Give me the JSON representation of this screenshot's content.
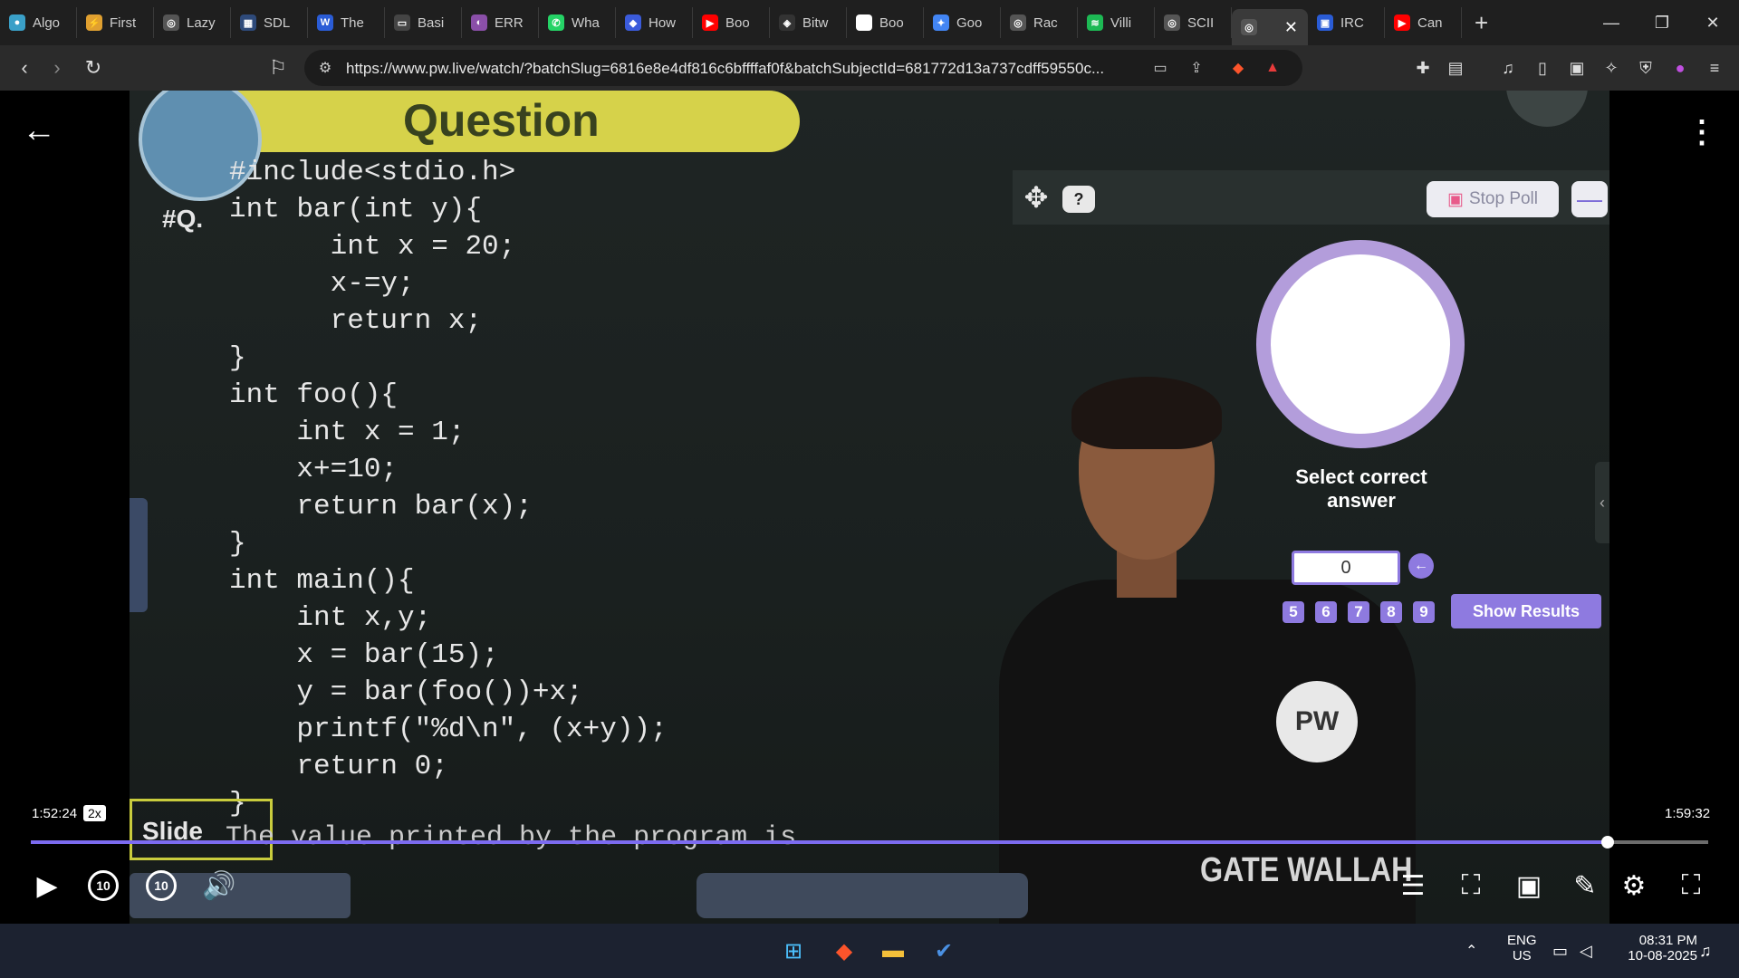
{
  "browser": {
    "tabs": [
      {
        "label": "Algo",
        "fav_color": "#3aa0c8",
        "fav": "●"
      },
      {
        "label": "First",
        "fav_color": "#e0a030",
        "fav": "⚡"
      },
      {
        "label": "Lazy",
        "fav_color": "#555555",
        "fav": "◎"
      },
      {
        "label": "SDL",
        "fav_color": "#2e4a7a",
        "fav": "▦"
      },
      {
        "label": "The",
        "fav_color": "#2a5cd6",
        "fav": "W"
      },
      {
        "label": "Basi",
        "fav_color": "#444444",
        "fav": "▭"
      },
      {
        "label": "ERR",
        "fav_color": "#8a4fa8",
        "fav": "◐"
      },
      {
        "label": "Wha",
        "fav_color": "#25d366",
        "fav": "✆"
      },
      {
        "label": "How",
        "fav_color": "#3b5bdb",
        "fav": "◆"
      },
      {
        "label": "Boo",
        "fav_color": "#ff0000",
        "fav": "▶"
      },
      {
        "label": "Bitw",
        "fav_color": "#333333",
        "fav": "◈"
      },
      {
        "label": "Boo",
        "fav_color": "#ffffff",
        "fav": "G"
      },
      {
        "label": "Goo",
        "fav_color": "#4285f4",
        "fav": "✦"
      },
      {
        "label": "Rac",
        "fav_color": "#555555",
        "fav": "◎"
      },
      {
        "label": "Villi",
        "fav_color": "#1db954",
        "fav": "≋"
      },
      {
        "label": "SCII",
        "fav_color": "#555555",
        "fav": "◎"
      },
      {
        "label": "",
        "fav_color": "#555555",
        "fav": "◎",
        "active": true
      },
      {
        "label": "IRC",
        "fav_color": "#2a5cd6",
        "fav": "▣"
      },
      {
        "label": "Can",
        "fav_color": "#ff0000",
        "fav": "▶"
      }
    ],
    "url": "https://www.pw.live/watch/?batchSlug=6816e8e4df816c6bffffaf0f&batchSubjectId=681772d13a737cdff59550c...",
    "brave_badge": "3"
  },
  "video": {
    "board": {
      "banner_title": "Question",
      "question_label": "#Q.",
      "code_lines": [
        "#include<stdio.h>",
        "int bar(int y){",
        "      int x = 20;",
        "      x-=y;",
        "      return x;",
        "}",
        "int foo(){",
        "    int x = 1;",
        "    x+=10;",
        "    return bar(x);",
        "}",
        "int main(){",
        "    int x,y;",
        "    x = bar(15);",
        "    y = bar(foo())+x;",
        "    printf(\"%d\\n\", (x+y));",
        "    return 0;",
        "}"
      ],
      "slide_label": "Slide",
      "question_text": "The value printed by the program is",
      "brand": "GATE WALLAH",
      "logo_text": "PW"
    },
    "poll": {
      "help": "?",
      "stop_poll": "Stop Poll",
      "minimize": "—",
      "title": "Select correct answer",
      "input_value": "0",
      "options": [
        "5",
        "6",
        "7",
        "8",
        "9"
      ],
      "show_results": "Show Results"
    },
    "player": {
      "current_time": "1:52:24",
      "speed": "2x",
      "total_time": "1:59:32",
      "progress": 0.94,
      "skip_back": "10",
      "skip_forward": "10"
    }
  },
  "taskbar": {
    "lang_line1": "ENG",
    "lang_line2": "US",
    "time": "08:31 PM",
    "date": "10-08-2025"
  }
}
